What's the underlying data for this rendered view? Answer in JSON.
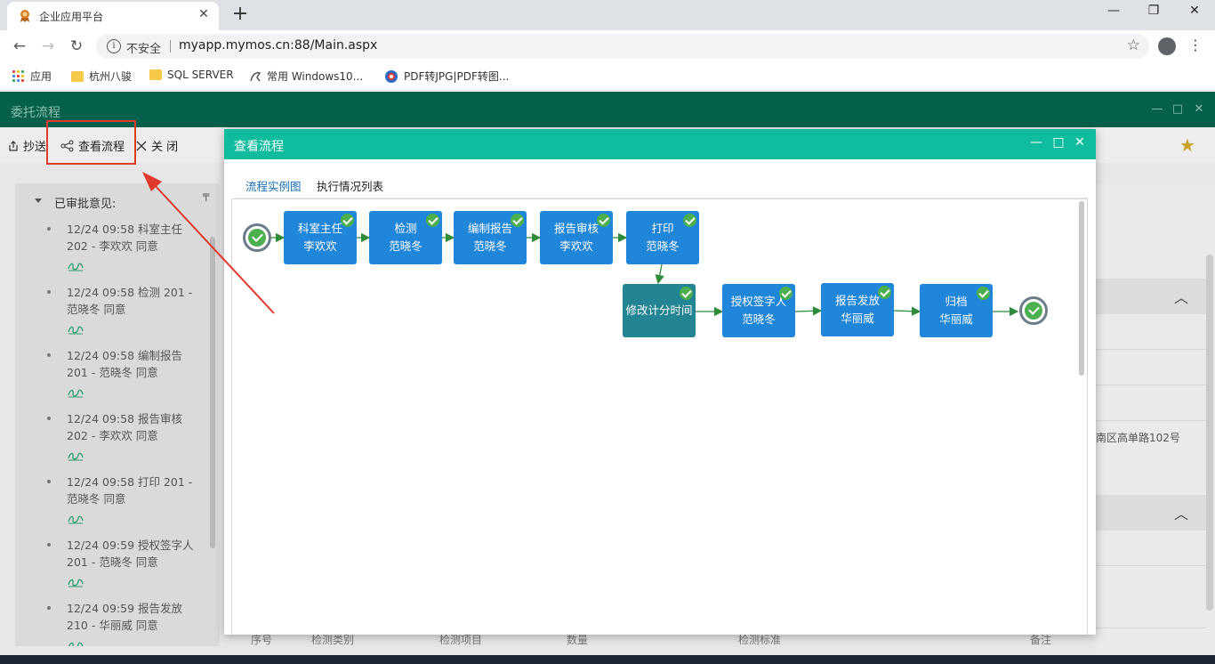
{
  "browser": {
    "tab_title": "企业应用平台",
    "tab_close": "✕",
    "new_tab": "+",
    "window_controls": {
      "minimize": "—",
      "restore": "❐",
      "close": "✕"
    },
    "nav": {
      "back": "←",
      "forward": "→",
      "reload": "↻"
    },
    "security_label": "不安全",
    "url": "myapp.mymos.cn:88/Main.aspx",
    "bookmark_star": "☆",
    "menu": "⋮",
    "bookmarks": [
      {
        "label": "应用",
        "icon": "apps-grid-icon"
      },
      {
        "label": "杭州八骏",
        "icon": "folder-icon"
      },
      {
        "label": "SQL SERVER",
        "icon": "folder-icon"
      },
      {
        "label": "常用 Windows10...",
        "icon": "page-icon"
      },
      {
        "label": "PDF转JPG|PDF转图...",
        "icon": "pdf-site-icon"
      }
    ]
  },
  "app": {
    "window_title": "委托流程",
    "window_controls": {
      "minimize": "—",
      "maximize": "□",
      "close": "✕"
    },
    "toolbar": {
      "copy_send": "抄送",
      "view_flow": "查看流程",
      "close": "关 闭"
    },
    "opinions": {
      "header": "已审批意见:",
      "pin": "╤",
      "items": [
        {
          "line1": "12/24 09:58 科室主任",
          "line2": "202 - 李欢欢 同意"
        },
        {
          "line1": "12/24 09:58 检测 201 -",
          "line2": "范晓冬 同意"
        },
        {
          "line1": "12/24 09:58 编制报告",
          "line2": "201 - 范晓冬 同意"
        },
        {
          "line1": "12/24 09:58 报告审核",
          "line2": "202 - 李欢欢 同意"
        },
        {
          "line1": "12/24 09:58 打印 201 -",
          "line2": "范晓冬 同意"
        },
        {
          "line1": "12/24 09:59 授权签字人",
          "line2": "201 - 范晓冬 同意"
        },
        {
          "line1": "12/24 09:59 报告发放",
          "line2": "210 - 华丽威 同意"
        }
      ]
    },
    "right_address_fragment": "南区高单路102号",
    "favorite": "★",
    "chevron": "︿",
    "table_headers": [
      "序号",
      "检测类别",
      "检测项目",
      "数量",
      "检测标准",
      "备注"
    ]
  },
  "modal": {
    "title": "查看流程",
    "controls": {
      "minimize": "—",
      "maximize": "□",
      "close": "✕"
    },
    "tabs": [
      {
        "label": "流程实例图",
        "active": true
      },
      {
        "label": "执行情况列表",
        "active": false
      }
    ],
    "flow": {
      "nodes": [
        {
          "name": "科室主任",
          "person": "李欢欢",
          "done": true
        },
        {
          "name": "检测",
          "person": "范晓冬",
          "done": true
        },
        {
          "name": "编制报告",
          "person": "范晓冬",
          "done": true
        },
        {
          "name": "报告审核",
          "person": "李欢欢",
          "done": true
        },
        {
          "name": "打印",
          "person": "范晓冬",
          "done": true
        },
        {
          "name": "修改计分时间",
          "person": "",
          "done": true
        },
        {
          "name": "授权签字人",
          "person": "范晓冬",
          "done": true
        },
        {
          "name": "报告发放",
          "person": "华丽威",
          "done": true
        },
        {
          "name": "归档",
          "person": "华丽威",
          "done": true
        }
      ]
    }
  },
  "colors": {
    "app_header": "#04604a",
    "modal_header": "#0fbd9e",
    "node_blue": "#1f86d9",
    "node_teal": "#238594",
    "check_green": "#4caf50",
    "edge_green": "#2e8b3a",
    "annotation_red": "#e03a2f"
  }
}
